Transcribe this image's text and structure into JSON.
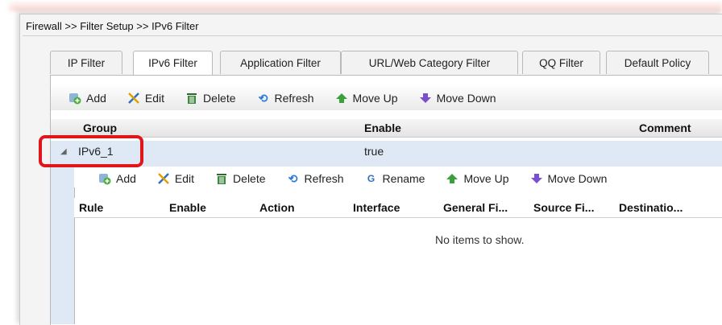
{
  "breadcrumb": "Firewall >> Filter Setup >> IPv6 Filter",
  "tabs": [
    {
      "label": "IP Filter",
      "active": false
    },
    {
      "label": "IPv6 Filter",
      "active": true
    },
    {
      "label": "Application Filter",
      "active": false
    },
    {
      "label": "URL/Web Category Filter",
      "active": false
    },
    {
      "label": "QQ Filter",
      "active": false
    },
    {
      "label": "Default Policy",
      "active": false
    }
  ],
  "toolbar": {
    "add": "Add",
    "edit": "Edit",
    "delete": "Delete",
    "refresh": "Refresh",
    "move_up": "Move Up",
    "move_down": "Move Down"
  },
  "group_table": {
    "columns": {
      "group": "Group",
      "enable": "Enable",
      "comment": "Comment"
    },
    "rows": [
      {
        "group": "IPv6_1",
        "enable": "true",
        "comment": ""
      }
    ]
  },
  "sub_toolbar": {
    "add": "Add",
    "edit": "Edit",
    "delete": "Delete",
    "refresh": "Refresh",
    "rename": "Rename",
    "move_up": "Move Up",
    "move_down": "Move Down"
  },
  "rule_table": {
    "columns": {
      "rule": "Rule",
      "enable": "Enable",
      "action": "Action",
      "interface": "Interface",
      "general": "General Fi...",
      "source": "Source Fi...",
      "destination": "Destinatio..."
    },
    "empty_message": "No items to show."
  },
  "colors": {
    "highlight": "#e0161b",
    "selected_row": "#dfe9f6"
  }
}
